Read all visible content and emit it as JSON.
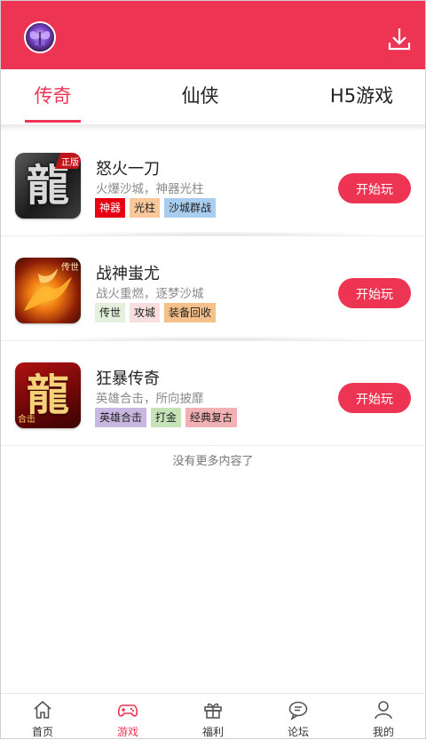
{
  "header": {
    "avatar_icon": "game-logo-avatar",
    "download_icon": "download-icon",
    "accent": "#ee3453"
  },
  "tabs": [
    {
      "label": "传奇",
      "active": true
    },
    {
      "label": "仙侠",
      "active": false
    },
    {
      "label": "H5游戏",
      "active": false
    }
  ],
  "games": [
    {
      "title": "怒火一刀",
      "desc": "火爆沙城，神器光柱",
      "icon_glyph": "龍",
      "icon_corner": "正版",
      "tags": [
        {
          "label": "神器",
          "color": "#e60012",
          "text_color": "#ffffff"
        },
        {
          "label": "光柱",
          "color": "#f8c89a",
          "text_color": "#222222"
        },
        {
          "label": "沙城群战",
          "color": "#a9cdee",
          "text_color": "#222222"
        }
      ],
      "button": "开始玩"
    },
    {
      "title": "战神蚩尤",
      "desc": "战火重燃，逐梦沙城",
      "icon_corner": "传世",
      "tags": [
        {
          "label": "传世",
          "color": "#e3f1dc",
          "text_color": "#222222"
        },
        {
          "label": "攻城",
          "color": "#f9dede",
          "text_color": "#222222"
        },
        {
          "label": "装备回收",
          "color": "#f6c08a",
          "text_color": "#222222"
        }
      ],
      "button": "开始玩"
    },
    {
      "title": "狂暴传奇",
      "desc": "英雄合击，所向披靡",
      "icon_glyph": "龍",
      "icon_corner": "合击",
      "tags": [
        {
          "label": "英雄合击",
          "color": "#c9b7e2",
          "text_color": "#222222"
        },
        {
          "label": "打金",
          "color": "#c6e3b8",
          "text_color": "#222222"
        },
        {
          "label": "经典复古",
          "color": "#f2b2b4",
          "text_color": "#222222"
        }
      ],
      "button": "开始玩"
    }
  ],
  "list_footer": "没有更多内容了",
  "bottom_nav": [
    {
      "label": "首页",
      "icon": "home-icon",
      "active": false
    },
    {
      "label": "游戏",
      "icon": "gamepad-icon",
      "active": true
    },
    {
      "label": "福利",
      "icon": "gift-icon",
      "active": false
    },
    {
      "label": "论坛",
      "icon": "chat-bubble-icon",
      "active": false
    },
    {
      "label": "我的",
      "icon": "user-icon",
      "active": false
    }
  ]
}
